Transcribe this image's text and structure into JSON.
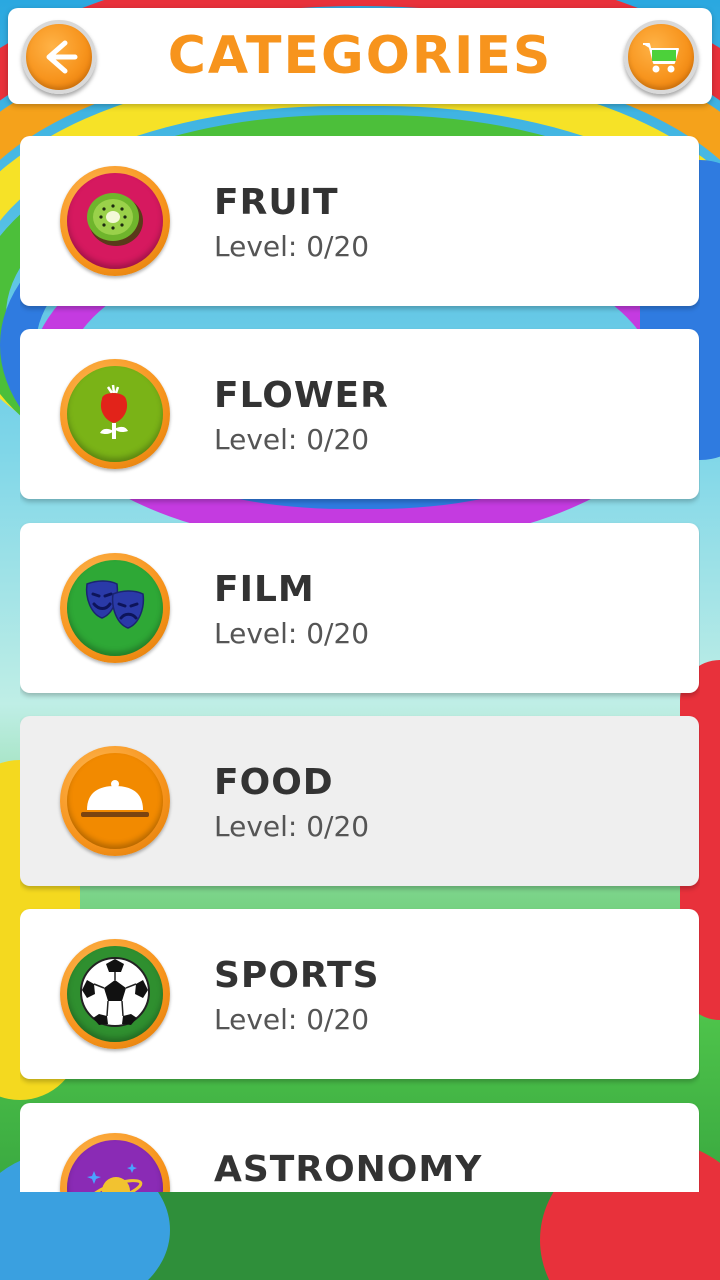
{
  "header": {
    "title": "CATEGORIES",
    "back_icon": "back-arrow-icon",
    "cart_icon": "shopping-cart-icon"
  },
  "colors": {
    "accent": "#f7941d",
    "card_bg": "#ffffff",
    "card_pressed_bg": "#efefef",
    "title_text": "#333333"
  },
  "categories": [
    {
      "name": "FRUIT",
      "level_text": "Level: 0/20",
      "icon": "kiwi-icon",
      "badge_color": "#d6195f"
    },
    {
      "name": "FLOWER",
      "level_text": "Level: 0/20",
      "icon": "rose-icon",
      "badge_color": "#7ab317"
    },
    {
      "name": "FILM",
      "level_text": "Level: 0/20",
      "icon": "theater-masks-icon",
      "badge_color": "#2ea836"
    },
    {
      "name": "FOOD",
      "level_text": "Level: 0/20",
      "icon": "food-cloche-icon",
      "badge_color": "#f28a00"
    },
    {
      "name": "SPORTS",
      "level_text": "Level: 0/20",
      "icon": "soccer-ball-icon",
      "badge_color": "#2f8f2f"
    },
    {
      "name": "ASTRONOMY",
      "level_text": "",
      "icon": "planet-icon",
      "badge_color": "#8a2bb5"
    }
  ]
}
